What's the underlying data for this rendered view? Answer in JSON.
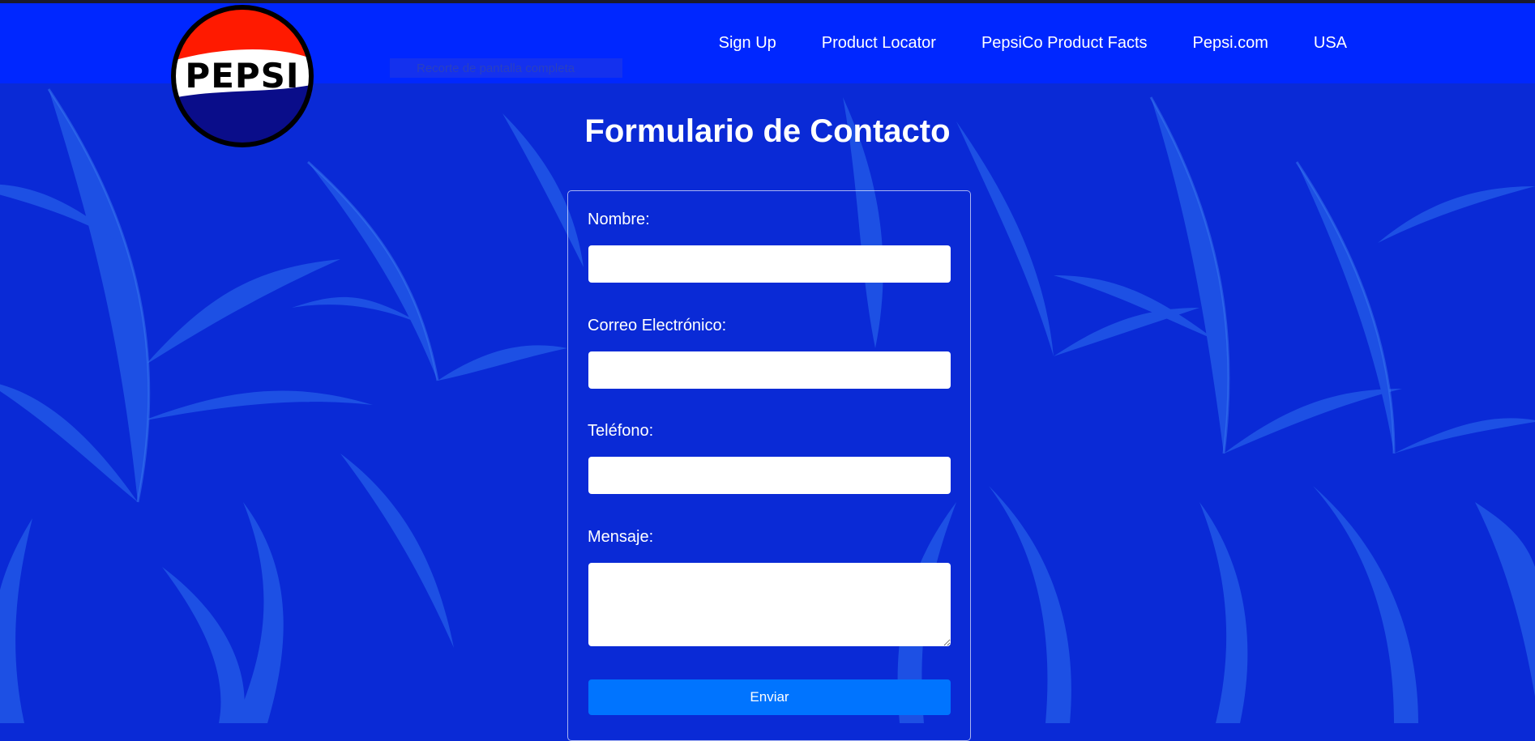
{
  "header": {
    "logo_text": "PEPSI",
    "nav": [
      "Sign Up",
      "Product Locator",
      "PepsiCo Product Facts",
      "Pepsi.com",
      "USA"
    ],
    "overlay_text": "Recorte de pantalla completa"
  },
  "page": {
    "title": "Formulario de Contacto"
  },
  "form": {
    "name_label": "Nombre:",
    "email_label": "Correo Electrónico:",
    "phone_label": "Teléfono:",
    "message_label": "Mensaje:",
    "name_value": "",
    "email_value": "",
    "phone_value": "",
    "message_value": "",
    "submit_label": "Enviar"
  },
  "colors": {
    "navbar": "#0027ff",
    "background": "#0a2ad6",
    "button": "#0074ff",
    "logo_red": "#ff1a00",
    "logo_blue": "#0a0d8a"
  }
}
